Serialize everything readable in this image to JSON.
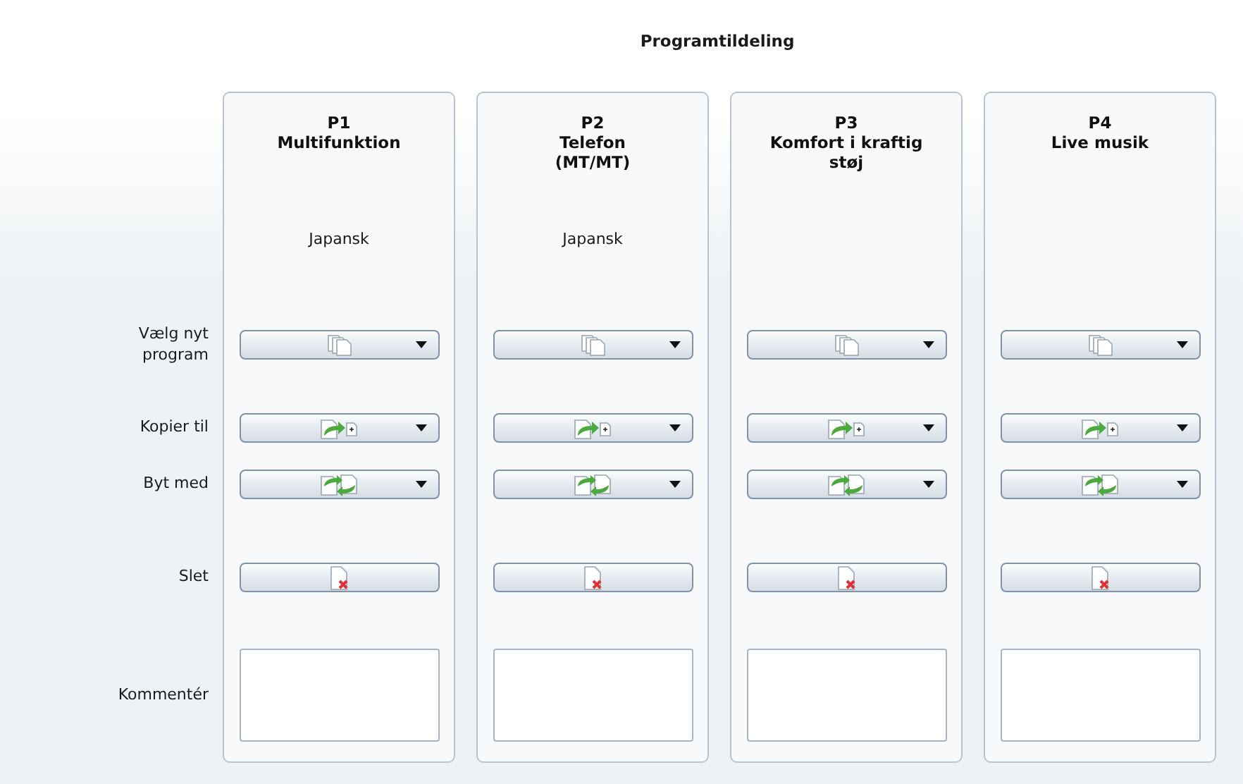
{
  "title": "Programtildeling",
  "actions": [
    {
      "label": "Vælg nyt program",
      "kind": "select",
      "dropdown": true
    },
    {
      "label": "Kopier til",
      "kind": "copy",
      "dropdown": true
    },
    {
      "label": "Byt med",
      "kind": "swap",
      "dropdown": true
    },
    {
      "label": "Slet",
      "kind": "delete",
      "dropdown": false
    }
  ],
  "comment_label": "Kommentér",
  "programs": [
    {
      "number": "P1",
      "name": "Multifunktion",
      "language": "Japansk"
    },
    {
      "number": "P2",
      "name": "Telefon\n(MT/MT)",
      "language": "Japansk"
    },
    {
      "number": "P3",
      "name": "Komfort i kraftig\nstøj"
    },
    {
      "number": "P4",
      "name": "Live musik"
    }
  ]
}
